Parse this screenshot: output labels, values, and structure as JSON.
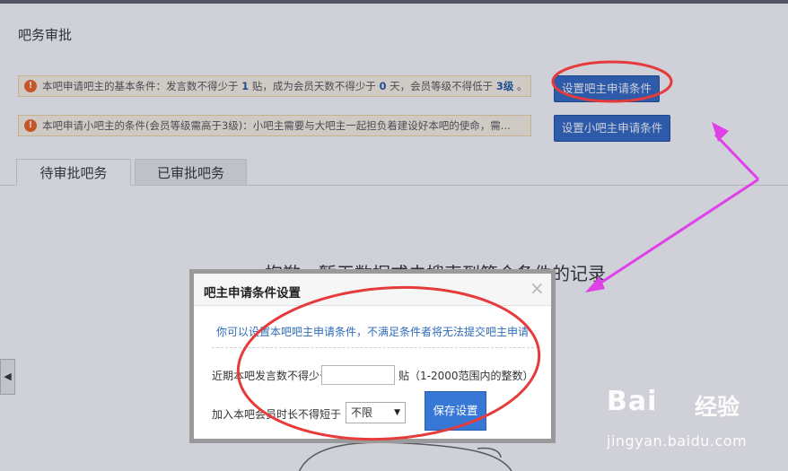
{
  "page": {
    "title": "吧务审批",
    "notice1": {
      "prefix": "本吧申请吧主的基本条件：发言数不得少于",
      "posts": "1",
      "mid1": "贴，成为会员天数不得少于",
      "days": "0",
      "mid2": "天，会员等级不得低于",
      "level": "3级",
      "suffix": "。"
    },
    "notice2": "本吧申请小吧主的条件(会员等级需高于3级)：小吧主需要与大吧主一起担负着建设好本吧的使命，需...",
    "btn_set_owner": "设置吧主申请条件",
    "btn_set_small_owner": "设置小吧主申请条件",
    "tabs": [
      "待审批吧务",
      "已审批吧务"
    ],
    "empty_message": "抱歉，暂无数据或未搜索到符合条件的记录"
  },
  "dialog": {
    "title": "吧主申请条件设置",
    "close_glyph": "×",
    "hint": "你可以设置本吧吧主申请条件，不满足条件者将无法提交吧主申请",
    "post_label": "近期本吧发言数不得少于",
    "post_value": "",
    "post_suffix": "贴（1-2000范围内的整数）",
    "member_label": "加入本吧会员时长不得短于",
    "member_selected": "不限",
    "save_label": "保存设置"
  },
  "watermark": {
    "logo": "Bai",
    "logo2": "经验",
    "url": "jingyan.baidu.com"
  },
  "colors": {
    "accent": "#2f69c3",
    "warning": "#f0641e",
    "annotation_red": "#e63b3b",
    "annotation_magenta": "#e040e8"
  }
}
